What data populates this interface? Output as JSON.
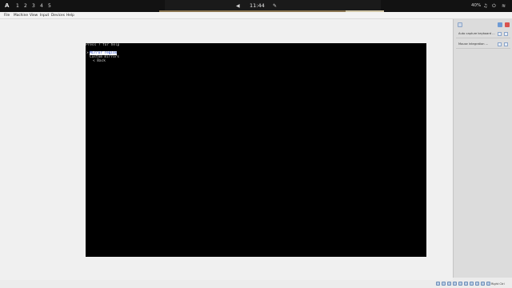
{
  "topbar": {
    "arch_logo": "A",
    "workspaces": [
      "1",
      "2",
      "3",
      "4",
      "5"
    ],
    "clock": "11:44",
    "volume": "40%"
  },
  "menu": [
    "File",
    "Machine",
    "View",
    "Input",
    "Devices",
    "Help"
  ],
  "vm": {
    "help_line": "Press ? for help",
    "selected_item": "Mirror region",
    "custom_item": "Custom mirrors",
    "back_item": "< Back"
  },
  "side_panel": {
    "rows": [
      "Auto capture keyboard ...",
      "Mouse integration ..."
    ]
  },
  "status": {
    "host_key": "Right Ctrl"
  },
  "colors": {
    "accent": "#8a7550",
    "selection_bg": "#ffffff",
    "selection_fg": "#1a3fc4"
  }
}
